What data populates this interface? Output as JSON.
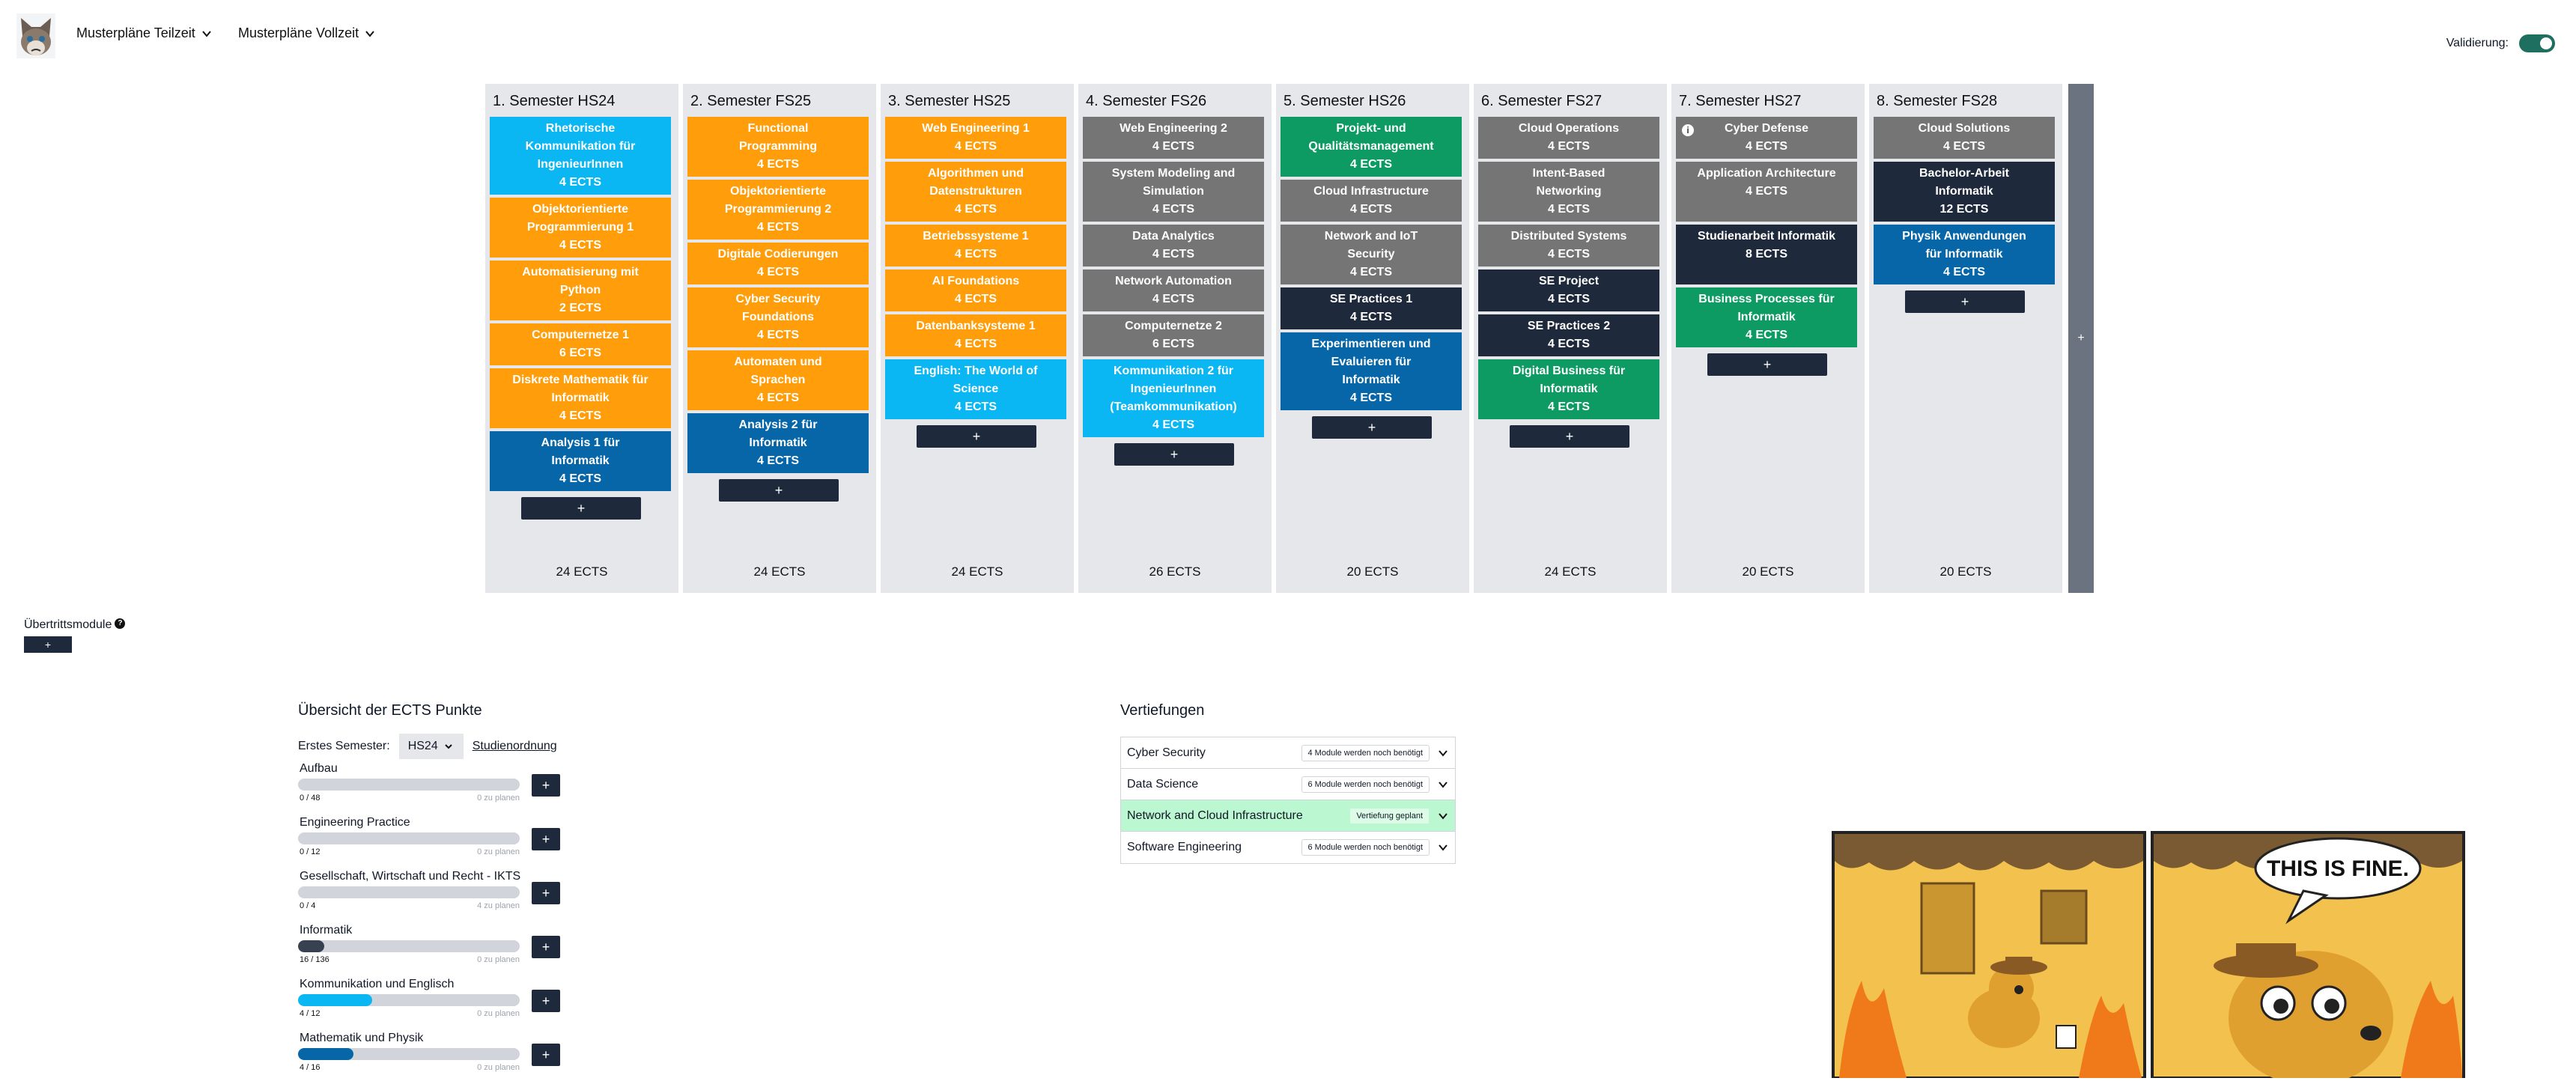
{
  "header": {
    "menu_teilzeit": "Musterpläne Teilzeit",
    "menu_vollzeit": "Musterpläne Vollzeit",
    "validation_label": "Validierung:",
    "validation_on": true,
    "avatar_icon": "cat-avatar-icon"
  },
  "colors": {
    "orange": "#ff9d0a",
    "cyan": "#0bb7f3",
    "blue": "#0666a8",
    "gray": "#757575",
    "navy": "#1e293b",
    "green": "#0e9b63",
    "toggle": "#1f6f60",
    "planned": "#bbf7d0"
  },
  "semesters": [
    {
      "title": "1. Semester HS24",
      "total": "24 ECTS",
      "add_label": "+",
      "modules": [
        {
          "name": "Rhetorische Kommunikation für IngenieurInnen",
          "ects": "4 ECTS",
          "color": "cyan"
        },
        {
          "name": "Objektorientierte Programmierung 1",
          "ects": "4 ECTS",
          "color": "orange"
        },
        {
          "name": "Automatisierung mit Python",
          "ects": "2 ECTS",
          "color": "orange"
        },
        {
          "name": "Computernetze 1",
          "ects": "6 ECTS",
          "color": "orange"
        },
        {
          "name": "Diskrete Mathematik für Informatik",
          "ects": "4 ECTS",
          "color": "orange"
        },
        {
          "name": "Analysis 1 für Informatik",
          "ects": "4 ECTS",
          "color": "blue"
        }
      ]
    },
    {
      "title": "2. Semester FS25",
      "total": "24 ECTS",
      "add_label": "+",
      "modules": [
        {
          "name": "Functional Programming",
          "ects": "4 ECTS",
          "color": "orange"
        },
        {
          "name": "Objektorientierte Programmierung 2",
          "ects": "4 ECTS",
          "color": "orange"
        },
        {
          "name": "Digitale Codierungen",
          "ects": "4 ECTS",
          "color": "orange"
        },
        {
          "name": "Cyber Security Foundations",
          "ects": "4 ECTS",
          "color": "orange"
        },
        {
          "name": "Automaten und Sprachen",
          "ects": "4 ECTS",
          "color": "orange"
        },
        {
          "name": "Analysis 2 für Informatik",
          "ects": "4 ECTS",
          "color": "blue"
        }
      ]
    },
    {
      "title": "3. Semester HS25",
      "total": "24 ECTS",
      "add_label": "+",
      "modules": [
        {
          "name": "Web Engineering 1",
          "ects": "4 ECTS",
          "color": "orange"
        },
        {
          "name": "Algorithmen und Datenstrukturen",
          "ects": "4 ECTS",
          "color": "orange"
        },
        {
          "name": "Betriebssysteme 1",
          "ects": "4 ECTS",
          "color": "orange"
        },
        {
          "name": "AI Foundations",
          "ects": "4 ECTS",
          "color": "orange"
        },
        {
          "name": "Datenbanksysteme 1",
          "ects": "4 ECTS",
          "color": "orange"
        },
        {
          "name": "English: The World of Science",
          "ects": "4 ECTS",
          "color": "cyan"
        }
      ]
    },
    {
      "title": "4. Semester FS26",
      "total": "26 ECTS",
      "add_label": "+",
      "modules": [
        {
          "name": "Web Engineering 2",
          "ects": "4 ECTS",
          "color": "gray"
        },
        {
          "name": "System Modeling and Simulation",
          "ects": "4 ECTS",
          "color": "gray"
        },
        {
          "name": "Data Analytics",
          "ects": "4 ECTS",
          "color": "gray"
        },
        {
          "name": "Network Automation",
          "ects": "4 ECTS",
          "color": "gray"
        },
        {
          "name": "Computernetze 2",
          "ects": "6 ECTS",
          "color": "gray"
        },
        {
          "name": "Kommunikation 2 für IngenieurInnen (Teamkommunikation)",
          "ects": "4 ECTS",
          "color": "cyan"
        }
      ]
    },
    {
      "title": "5. Semester HS26",
      "total": "20 ECTS",
      "add_label": "+",
      "modules": [
        {
          "name": "Projekt- und Qualitätsmanagement",
          "ects": "4 ECTS",
          "color": "green"
        },
        {
          "name": "Cloud Infrastructure",
          "ects": "4 ECTS",
          "color": "gray"
        },
        {
          "name": "Network and IoT Security",
          "ects": "4 ECTS",
          "color": "gray"
        },
        {
          "name": "SE Practices 1",
          "ects": "4 ECTS",
          "color": "navy"
        },
        {
          "name": "Experimentieren und Evaluieren für Informatik",
          "ects": "4 ECTS",
          "color": "blue"
        }
      ]
    },
    {
      "title": "6. Semester FS27",
      "total": "24 ECTS",
      "add_label": "+",
      "modules": [
        {
          "name": "Cloud Operations",
          "ects": "4 ECTS",
          "color": "gray"
        },
        {
          "name": "Intent-Based Networking",
          "ects": "4 ECTS",
          "color": "gray"
        },
        {
          "name": "Distributed Systems",
          "ects": "4 ECTS",
          "color": "gray"
        },
        {
          "name": "SE Project",
          "ects": "4 ECTS",
          "color": "navy"
        },
        {
          "name": "SE Practices 2",
          "ects": "4 ECTS",
          "color": "navy"
        },
        {
          "name": "Digital Business für Informatik",
          "ects": "4 ECTS",
          "color": "green"
        }
      ]
    },
    {
      "title": "7. Semester HS27",
      "total": "20 ECTS",
      "add_label": "+",
      "modules": [
        {
          "name": "Cyber Defense",
          "ects": "4 ECTS",
          "color": "gray",
          "info": true
        },
        {
          "name": "Application Architecture",
          "ects": "4 ECTS",
          "color": "gray"
        },
        {
          "name": "Studienarbeit Informatik",
          "ects": "8 ECTS",
          "color": "navy"
        },
        {
          "name": "Business Processes für Informatik",
          "ects": "4 ECTS",
          "color": "green"
        }
      ]
    },
    {
      "title": "8. Semester FS28",
      "total": "20 ECTS",
      "add_label": "+",
      "modules": [
        {
          "name": "Cloud Solutions",
          "ects": "4 ECTS",
          "color": "gray"
        },
        {
          "name": "Bachelor-Arbeit Informatik",
          "ects": "12 ECTS",
          "color": "navy"
        },
        {
          "name": "Physik Anwendungen für Informatik",
          "ects": "4 ECTS",
          "color": "blue"
        }
      ]
    }
  ],
  "add_semester_label": "+",
  "uebertritt": {
    "label": "Übertrittsmodule",
    "add_label": "+"
  },
  "ects_overview": {
    "title": "Übersicht der ECTS Punkte",
    "first_semester_label": "Erstes Semester:",
    "first_semester_value": "HS24",
    "studienordnung_link": "Studienordnung",
    "categories": [
      {
        "name": "Aufbau",
        "count": "0 / 48",
        "plan": "0 zu planen",
        "progress": 0,
        "color": "#9ca3af"
      },
      {
        "name": "Engineering Practice",
        "count": "0 / 12",
        "plan": "0 zu planen",
        "progress": 0,
        "color": "#9ca3af"
      },
      {
        "name": "Gesellschaft, Wirtschaft und Recht - IKTS",
        "count": "0 / 4",
        "plan": "4 zu planen",
        "progress": 0,
        "color": "#9ca3af"
      },
      {
        "name": "Informatik",
        "count": "16 / 136",
        "plan": "0 zu planen",
        "progress": 0.118,
        "color": "#374151"
      },
      {
        "name": "Kommunikation und Englisch",
        "count": "4 / 12",
        "plan": "0 zu planen",
        "progress": 0.333,
        "color": "#0bb7f3"
      },
      {
        "name": "Mathematik und Physik",
        "count": "4 / 16",
        "plan": "0 zu planen",
        "progress": 0.25,
        "color": "#0666a8"
      }
    ],
    "add_label": "+"
  },
  "vertiefungen": {
    "title": "Vertiefungen",
    "items": [
      {
        "name": "Cyber Security",
        "badge": "4 Module werden noch benötigt",
        "planned": false
      },
      {
        "name": "Data Science",
        "badge": "6 Module werden noch benötigt",
        "planned": false
      },
      {
        "name": "Network and Cloud Infrastructure",
        "badge": "Vertiefung geplant",
        "planned": true
      },
      {
        "name": "Software Engineering",
        "badge": "6 Module werden noch benötigt",
        "planned": false
      }
    ]
  },
  "meme": {
    "speech": "THIS IS FINE.",
    "icon": "this-is-fine-dog-image"
  }
}
